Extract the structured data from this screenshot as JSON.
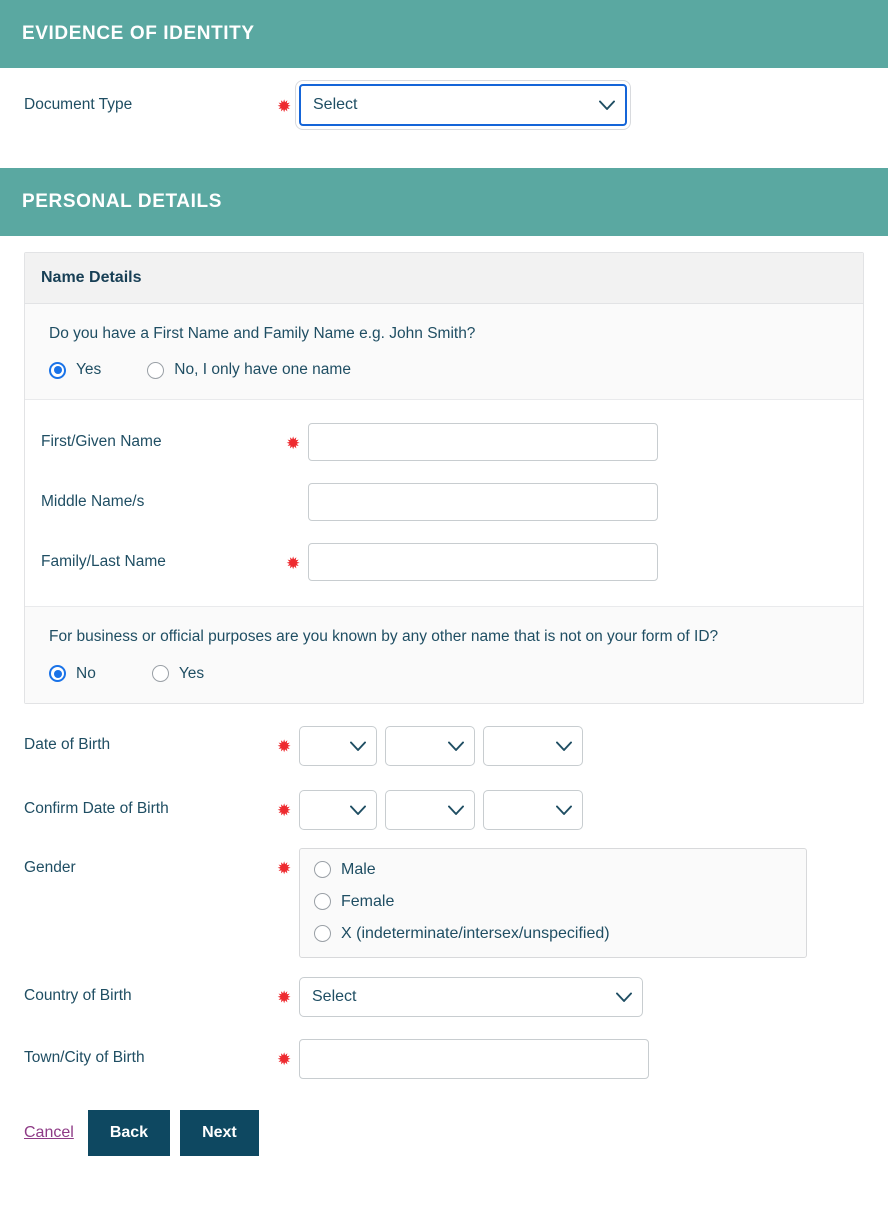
{
  "sections": {
    "evidence_of_identity": {
      "banner_title": "EVIDENCE OF IDENTITY",
      "document_type": {
        "label": "Document Type",
        "required_marker": "✹",
        "value": "Select"
      }
    },
    "personal_details": {
      "banner_title": "PERSONAL DETAILS",
      "name_details": {
        "panel_title": "Name Details",
        "question_one": {
          "text": "Do you have a First Name and Family Name e.g. John Smith?",
          "options": [
            {
              "label": "Yes",
              "selected": true
            },
            {
              "label": "No, I only have one name",
              "selected": false
            }
          ]
        },
        "fields": [
          {
            "label": "First/Given Name",
            "required_marker": "✹",
            "value": ""
          },
          {
            "label": "Middle Name/s",
            "required_marker": "",
            "value": ""
          },
          {
            "label": "Family/Last Name",
            "required_marker": "✹",
            "value": ""
          }
        ],
        "question_two": {
          "text": "For business or official purposes are you known by any other name that is not on your form of ID?",
          "options": [
            {
              "label": "No",
              "selected": true
            },
            {
              "label": "Yes",
              "selected": false
            }
          ]
        }
      },
      "date_of_birth": {
        "label": "Date of Birth",
        "required_marker": "✹",
        "day": "",
        "month": "",
        "year": ""
      },
      "confirm_date_of_birth": {
        "label": "Confirm Date of Birth",
        "required_marker": "✹",
        "day": "",
        "month": "",
        "year": ""
      },
      "gender": {
        "label": "Gender",
        "required_marker": "✹",
        "options": [
          {
            "label": "Male",
            "selected": false
          },
          {
            "label": "Female",
            "selected": false
          },
          {
            "label": "X (indeterminate/intersex/unspecified)",
            "selected": false
          }
        ]
      },
      "country_of_birth": {
        "label": "Country of Birth",
        "required_marker": "✹",
        "value": "Select"
      },
      "town_city_of_birth": {
        "label": "Town/City of Birth",
        "required_marker": "✹",
        "value": ""
      }
    }
  },
  "footer": {
    "cancel_label": "Cancel",
    "back_label": "Back",
    "next_label": "Next"
  },
  "colors": {
    "banner_teal": "#5aa8a1",
    "text_navy": "#1f4e63",
    "required_red": "#ee2b30",
    "button_navy": "#0e4861",
    "link_purple": "#8e3b86",
    "focus_blue": "#1565d8",
    "radio_blue": "#1a73e8"
  }
}
